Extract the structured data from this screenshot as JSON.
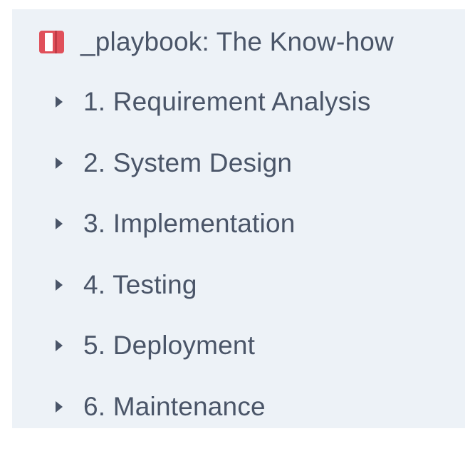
{
  "sidebar": {
    "root": {
      "title": "_playbook: The Know-how",
      "icon": "book-icon",
      "icon_color": "#e0505a"
    },
    "items": [
      {
        "label": "1. Requirement Analysis",
        "icon": "caret-right-icon"
      },
      {
        "label": "2. System Design",
        "icon": "caret-right-icon"
      },
      {
        "label": "3. Implementation",
        "icon": "caret-right-icon"
      },
      {
        "label": "4. Testing",
        "icon": "caret-right-icon"
      },
      {
        "label": "5. Deployment",
        "icon": "caret-right-icon"
      },
      {
        "label": "6. Maintenance",
        "icon": "caret-right-icon"
      }
    ],
    "colors": {
      "background": "#edf2f7",
      "text": "#4a5568"
    }
  }
}
